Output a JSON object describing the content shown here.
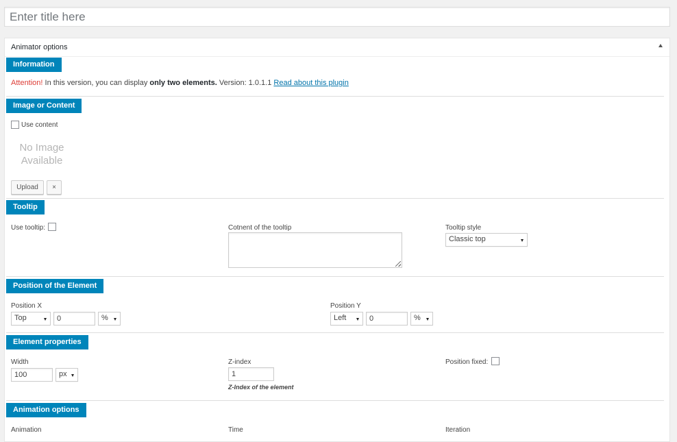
{
  "title_field": {
    "placeholder": "Enter title here",
    "value": ""
  },
  "metabox": {
    "title": "Animator options"
  },
  "information": {
    "heading": "Information",
    "attention": "Attention!",
    "text_before": " In this version, you can display ",
    "bold": "only two elements.",
    "version": " Version: 1.0.1.1 ",
    "link": "Read about this plugin"
  },
  "image_content": {
    "heading": "Image or Content",
    "use_content_label": "Use content",
    "no_image_line1": "No Image",
    "no_image_line2": "Available",
    "upload_label": "Upload",
    "remove_label": "×"
  },
  "tooltip": {
    "heading": "Tooltip",
    "use_label": "Use tooltip:",
    "content_label": "Cotnent of the tooltip",
    "style_label": "Tooltip style",
    "style_value": "Classic top"
  },
  "position": {
    "heading": "Position of the Element",
    "x_label": "Position X",
    "x_anchor": "Top",
    "x_value": "0",
    "x_unit": "%",
    "y_label": "Position Y",
    "y_anchor": "Left",
    "y_value": "0",
    "y_unit": "%"
  },
  "properties": {
    "heading": "Element properties",
    "width_label": "Width",
    "width_value": "100",
    "width_unit": "px",
    "zindex_label": "Z-index",
    "zindex_value": "1",
    "zindex_hint": "Z-Index of the element",
    "fixed_label": "Position fixed:"
  },
  "animation": {
    "heading": "Animation options",
    "animation_label": "Animation",
    "time_label": "Time",
    "iteration_label": "Iteration"
  },
  "colors": {
    "accent": "#0085ba",
    "attention": "#dd3d36",
    "link": "#0073aa"
  }
}
